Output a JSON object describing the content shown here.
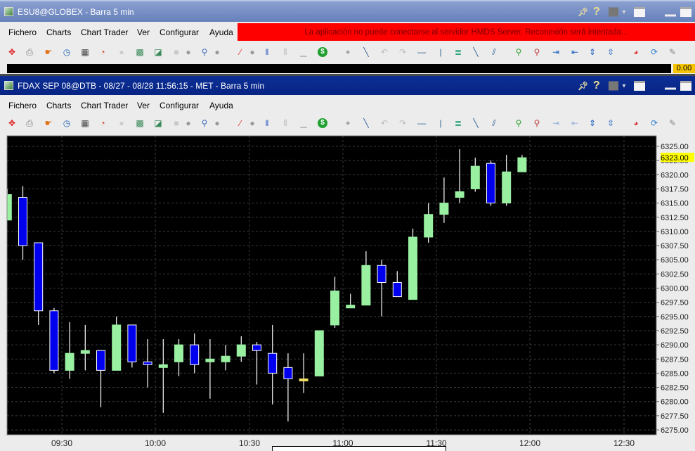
{
  "window1": {
    "title": "ESU8@GLOBEX - Barra 5 min",
    "menu": [
      "Fichero",
      "Charts",
      "Chart Trader",
      "Ver",
      "Configurar",
      "Ayuda"
    ],
    "menu_mnemonic": [
      "F",
      "C",
      "T",
      "V",
      "o",
      "A"
    ],
    "banner": "La aplicación no puede conectarse al servidor HMDS Server. Reconexión será intentada...",
    "last_price": "0.00"
  },
  "window2": {
    "title": "FDAX SEP 08@DTB - 08/27 - 08/28 11:56:15  - MET - Barra 5 min",
    "menu": [
      "Fichero",
      "Charts",
      "Chart Trader",
      "Ver",
      "Configurar",
      "Ayuda"
    ]
  },
  "toolbar_icons": [
    "crosshair-target",
    "print",
    "hand-pointer",
    "clock",
    "grid",
    "speedometer",
    "disabled-circle",
    "add-study",
    "add-chart",
    "disabled-square",
    "dropdown",
    "zoom",
    "dropdown",
    "pencil",
    "dropdown",
    "bar-chart",
    "volume-bars",
    "histogram",
    "dollar",
    "crosshair",
    "trendline",
    "undo",
    "redo",
    "horizontal-line",
    "vertical-line",
    "fibonacci",
    "ray",
    "channel",
    "zoom-in",
    "zoom-out",
    "scroll-right",
    "scroll-left",
    "expand-vertical",
    "compress-vertical",
    "color-palette",
    "refresh",
    "wrench"
  ],
  "colors": {
    "up": "#98f0a0",
    "down": "#0000ee",
    "doji": "#f0e060",
    "last_price_bg": "#ffff00",
    "banner": "#ff0000"
  },
  "chart_data": {
    "type": "candlestick",
    "ylim": [
      6275,
      6325
    ],
    "y_ticks": [
      "6325.00",
      "6322.50",
      "6320.00",
      "6317.50",
      "6315.00",
      "6312.50",
      "6310.00",
      "6307.50",
      "6305.00",
      "6302.50",
      "6300.00",
      "6297.50",
      "6295.00",
      "6292.50",
      "6290.00",
      "6287.50",
      "6285.00",
      "6282.50",
      "6280.00",
      "6277.50",
      "6275.00"
    ],
    "last_price": "6323.00",
    "x_ticks": [
      "09:30",
      "10:00",
      "10:30",
      "11:00",
      "11:30",
      "12:00",
      "12:30"
    ],
    "bar_interval_min": 5,
    "candles": [
      {
        "t": "09:10",
        "o": 6312,
        "h": 6317.5,
        "l": 6312,
        "c": 6316.5
      },
      {
        "t": "09:15",
        "o": 6316,
        "h": 6318,
        "l": 6305,
        "c": 6307.5
      },
      {
        "t": "09:20",
        "o": 6308,
        "h": 6308,
        "l": 6293.5,
        "c": 6296
      },
      {
        "t": "09:25",
        "o": 6296,
        "h": 6296.5,
        "l": 6285,
        "c": 6285.5
      },
      {
        "t": "09:30",
        "o": 6285.5,
        "h": 6294,
        "l": 6284,
        "c": 6288.5
      },
      {
        "t": "09:35",
        "o": 6288.5,
        "h": 6293.5,
        "l": 6285.5,
        "c": 6289
      },
      {
        "t": "09:40",
        "o": 6289,
        "h": 6289,
        "l": 6279,
        "c": 6285.5
      },
      {
        "t": "09:45",
        "o": 6285.5,
        "h": 6295,
        "l": 6285.5,
        "c": 6293.5
      },
      {
        "t": "09:50",
        "o": 6293.5,
        "h": 6293.5,
        "l": 6286,
        "c": 6287
      },
      {
        "t": "09:55",
        "o": 6287,
        "h": 6291,
        "l": 6282.5,
        "c": 6286.5
      },
      {
        "t": "10:00",
        "o": 6286,
        "h": 6291,
        "l": 6278,
        "c": 6286.5
      },
      {
        "t": "10:05",
        "o": 6287,
        "h": 6291,
        "l": 6284.5,
        "c": 6290
      },
      {
        "t": "10:10",
        "o": 6290,
        "h": 6292,
        "l": 6285,
        "c": 6286.5
      },
      {
        "t": "10:15",
        "o": 6287,
        "h": 6291,
        "l": 6280.5,
        "c": 6287.5
      },
      {
        "t": "10:20",
        "o": 6287,
        "h": 6290,
        "l": 6285.5,
        "c": 6288
      },
      {
        "t": "10:25",
        "o": 6288,
        "h": 6291.5,
        "l": 6287,
        "c": 6290
      },
      {
        "t": "10:30",
        "o": 6290,
        "h": 6290.5,
        "l": 6283,
        "c": 6289
      },
      {
        "t": "10:35",
        "o": 6288.5,
        "h": 6293.5,
        "l": 6279.5,
        "c": 6285
      },
      {
        "t": "10:40",
        "o": 6286,
        "h": 6288.5,
        "l": 6276.5,
        "c": 6284
      },
      {
        "t": "10:45",
        "o": 6284,
        "h": 6288.5,
        "l": 6281.5,
        "c": 6284
      },
      {
        "t": "10:50",
        "o": 6284.5,
        "h": 6292.5,
        "l": 6284.5,
        "c": 6292.5
      },
      {
        "t": "10:55",
        "o": 6293.5,
        "h": 6302,
        "l": 6293,
        "c": 6299.5
      },
      {
        "t": "11:00",
        "o": 6296.5,
        "h": 6299,
        "l": 6296.5,
        "c": 6297
      },
      {
        "t": "11:05",
        "o": 6297,
        "h": 6306.5,
        "l": 6297,
        "c": 6304
      },
      {
        "t": "11:10",
        "o": 6304,
        "h": 6305,
        "l": 6295,
        "c": 6301
      },
      {
        "t": "11:15",
        "o": 6301,
        "h": 6303,
        "l": 6298.5,
        "c": 6298.5
      },
      {
        "t": "11:20",
        "o": 6298,
        "h": 6310.5,
        "l": 6298,
        "c": 6309
      },
      {
        "t": "11:25",
        "o": 6309,
        "h": 6315,
        "l": 6308,
        "c": 6313
      },
      {
        "t": "11:30",
        "o": 6313,
        "h": 6319.5,
        "l": 6311.5,
        "c": 6315
      },
      {
        "t": "11:35",
        "o": 6316,
        "h": 6324.5,
        "l": 6315,
        "c": 6317
      },
      {
        "t": "11:40",
        "o": 6317.5,
        "h": 6323,
        "l": 6317,
        "c": 6321.5
      },
      {
        "t": "11:45",
        "o": 6322,
        "h": 6322.5,
        "l": 6314.5,
        "c": 6315
      },
      {
        "t": "11:50",
        "o": 6315,
        "h": 6323.5,
        "l": 6314.5,
        "c": 6320.5
      },
      {
        "t": "11:55",
        "o": 6320.5,
        "h": 6323.5,
        "l": 6320.5,
        "c": 6323
      }
    ]
  }
}
